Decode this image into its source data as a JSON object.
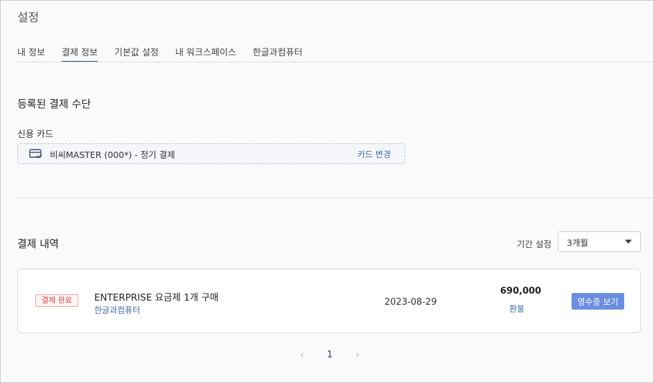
{
  "page_title": "설정",
  "tabs": [
    {
      "label": "내 정보",
      "active": false
    },
    {
      "label": "결제 정보",
      "active": true
    },
    {
      "label": "기본값 설정",
      "active": false
    },
    {
      "label": "내 워크스페이스",
      "active": false
    },
    {
      "label": "한글과컴퓨터",
      "active": false
    }
  ],
  "payment_method": {
    "section_title": "등록된 결제 수단",
    "sub_label": "신용 카드",
    "card_text": "비씨MASTER (000*) - 정기 결제",
    "change_label": "카드 변경",
    "card_icon": "credit-card-icon"
  },
  "history": {
    "section_title": "결제 내역",
    "period_label": "기간 설정",
    "period_value": "3개월",
    "items": [
      {
        "status": "결제 완료",
        "title": "ENTERPRISE 요금제 1개 구매",
        "org": "한글과컴퓨터",
        "date": "2023-08-29",
        "amount": "690,000",
        "refund_label": "환불",
        "receipt_label": "영수증 보기"
      }
    ]
  },
  "pagination": {
    "prev": "‹",
    "current_page": "1",
    "next": "›"
  },
  "colors": {
    "accent": "#3b4a6b",
    "link": "#3e6aa8",
    "button": "#6b8ee0",
    "status_red": "#d24b4b"
  }
}
